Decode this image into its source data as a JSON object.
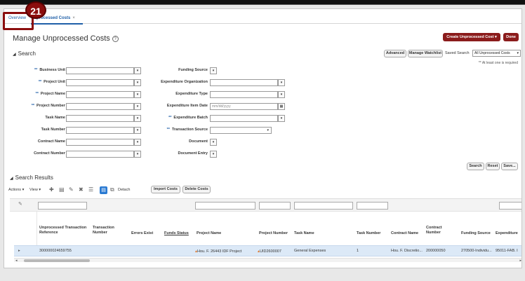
{
  "callout": {
    "number": "21"
  },
  "tabs": [
    {
      "label": "Overview"
    },
    {
      "label": "Unprocessed Costs",
      "close": "×"
    }
  ],
  "page": {
    "title": "Manage Unprocessed Costs",
    "help": "?"
  },
  "header_buttons": {
    "create": "Create Unprocessed Cost",
    "create_caret": "▾",
    "done": "Done"
  },
  "search": {
    "title": "Search",
    "advanced": "Advanced",
    "manage_watchlist": "Manage Watchlist",
    "saved_search_label": "Saved Search",
    "saved_search_value": "All Unprocessed Costs",
    "hint": "** At least one is required",
    "left_fields": [
      {
        "label": "Business Unit",
        "required": "**"
      },
      {
        "label": "Project Unit",
        "required": "**"
      },
      {
        "label": "Project Name",
        "required": "**"
      },
      {
        "label": "Project Number",
        "required": "**"
      },
      {
        "label": "Task Name",
        "required": ""
      },
      {
        "label": "Task Number",
        "required": ""
      },
      {
        "label": "Contract Name",
        "required": ""
      },
      {
        "label": "Contract Number",
        "required": ""
      }
    ],
    "right_fields": [
      {
        "label": "Funding Source",
        "required": ""
      },
      {
        "label": "Expenditure Organization",
        "required": ""
      },
      {
        "label": "Expenditure Type",
        "required": ""
      },
      {
        "label": "Expenditure Item Date",
        "required": "",
        "placeholder": "mm/dd/yyyy"
      },
      {
        "label": "Expenditure Batch",
        "required": "**"
      },
      {
        "label": "Transaction Source",
        "required": "**"
      },
      {
        "label": "Document",
        "required": ""
      },
      {
        "label": "Document Entry",
        "required": ""
      }
    ],
    "buttons": {
      "search": "Search",
      "reset": "Reset",
      "save": "Save..."
    }
  },
  "results": {
    "title": "Search Results",
    "toolbar": {
      "actions": "Actions ▾",
      "view": "View ▾",
      "detach": "Detach",
      "import_costs": "Import Costs",
      "delete_costs": "Delete Costs"
    },
    "columns": [
      "Unprocessed Transaction Reference",
      "Transaction Number",
      "Errors Exist",
      "Funds Status",
      "Project Name",
      "Project Number",
      "Task Name",
      "Task Number",
      "Contract Name",
      "Contract Number",
      "Funding Source",
      "Expenditure"
    ],
    "row": {
      "ref": "300000024659755",
      "project_name": "Hou. F. 26443 IDF Project",
      "project_number": "UID2600007",
      "task_name": "General Expenses",
      "task_number": "1",
      "contract_name": "Hou. F. Discretio...",
      "contract_number": "200000050",
      "funding_source": "270500-Individu...",
      "expenditure": "95011-FAB. I"
    }
  }
}
